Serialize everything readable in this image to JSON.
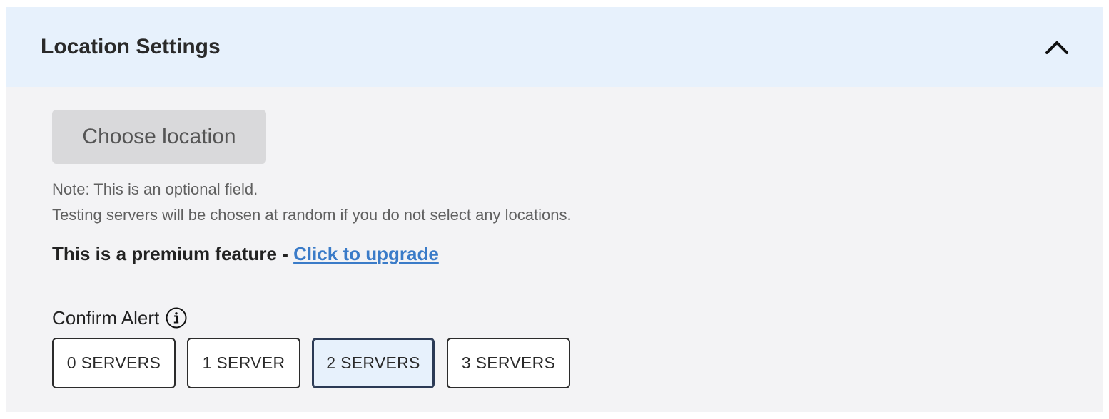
{
  "panel": {
    "title": "Location Settings",
    "collapse_icon": "chevron-up-icon"
  },
  "choose_location": {
    "label": "Choose location"
  },
  "notes": {
    "line1": "Note: This is an optional field.",
    "line2": "Testing servers will be chosen at random if you do not select any locations."
  },
  "premium": {
    "text": "This is a premium feature - ",
    "link_label": "Click to upgrade"
  },
  "confirm_alert": {
    "label": "Confirm Alert",
    "info_icon": "info-icon",
    "options": [
      {
        "label": "0 SERVERS",
        "selected": false
      },
      {
        "label": "1 SERVER",
        "selected": false
      },
      {
        "label": "2 SERVERS",
        "selected": true
      },
      {
        "label": "3 SERVERS",
        "selected": false
      }
    ]
  },
  "colors": {
    "header_bg": "#e7f1fc",
    "panel_bg": "#f3f3f5",
    "link": "#3a7bc8",
    "selected_bg": "#e7f1fc"
  }
}
